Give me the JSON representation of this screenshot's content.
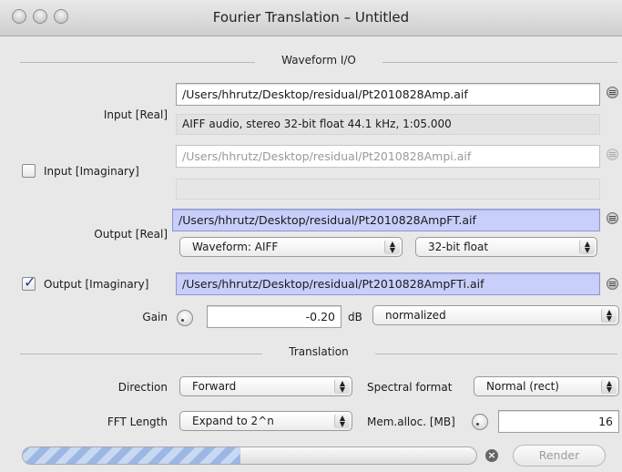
{
  "window": {
    "title": "Fourier Translation – Untitled"
  },
  "waveform_io": {
    "header": "Waveform I/O",
    "input_real": {
      "label": "Input [Real]",
      "path": "/Users/hhrutz/Desktop/residual/Pt2010828Amp.aif",
      "info": "AIFF audio, stereo 32-bit float 44.1 kHz, 1:05.000"
    },
    "input_imag": {
      "label": "Input [Imaginary]",
      "checked": false,
      "path": "/Users/hhrutz/Desktop/residual/Pt2010828Ampi.aif",
      "info": ""
    },
    "output_real": {
      "label": "Output [Real]",
      "path": "/Users/hhrutz/Desktop/residual/Pt2010828AmpFT.aif",
      "format": "Waveform: AIFF",
      "resolution": "32-bit float"
    },
    "output_imag": {
      "label": "Output [Imaginary]",
      "checked": true,
      "check_glyph": "✓",
      "path": "/Users/hhrutz/Desktop/residual/Pt2010828AmpFTi.aif"
    },
    "gain": {
      "label": "Gain",
      "value": "-0.20",
      "unit": "dB",
      "mode": "normalized"
    }
  },
  "translation": {
    "header": "Translation",
    "direction": {
      "label": "Direction",
      "value": "Forward"
    },
    "spectral_format": {
      "label": "Spectral format",
      "value": "Normal (rect)"
    },
    "fft_length": {
      "label": "FFT Length",
      "value": "Expand to 2^n"
    },
    "mem_alloc": {
      "label": "Mem.alloc. [MB]",
      "value": "16"
    }
  },
  "footer": {
    "progress": 0.48,
    "stop_glyph": "×",
    "render_label": "Render"
  },
  "glyphs": {
    "popup_arrows_up": "▲",
    "popup_arrows_down": "▼"
  },
  "colors": {
    "active_field": "#c9cffb",
    "checkmark": "#1f3e9c"
  }
}
